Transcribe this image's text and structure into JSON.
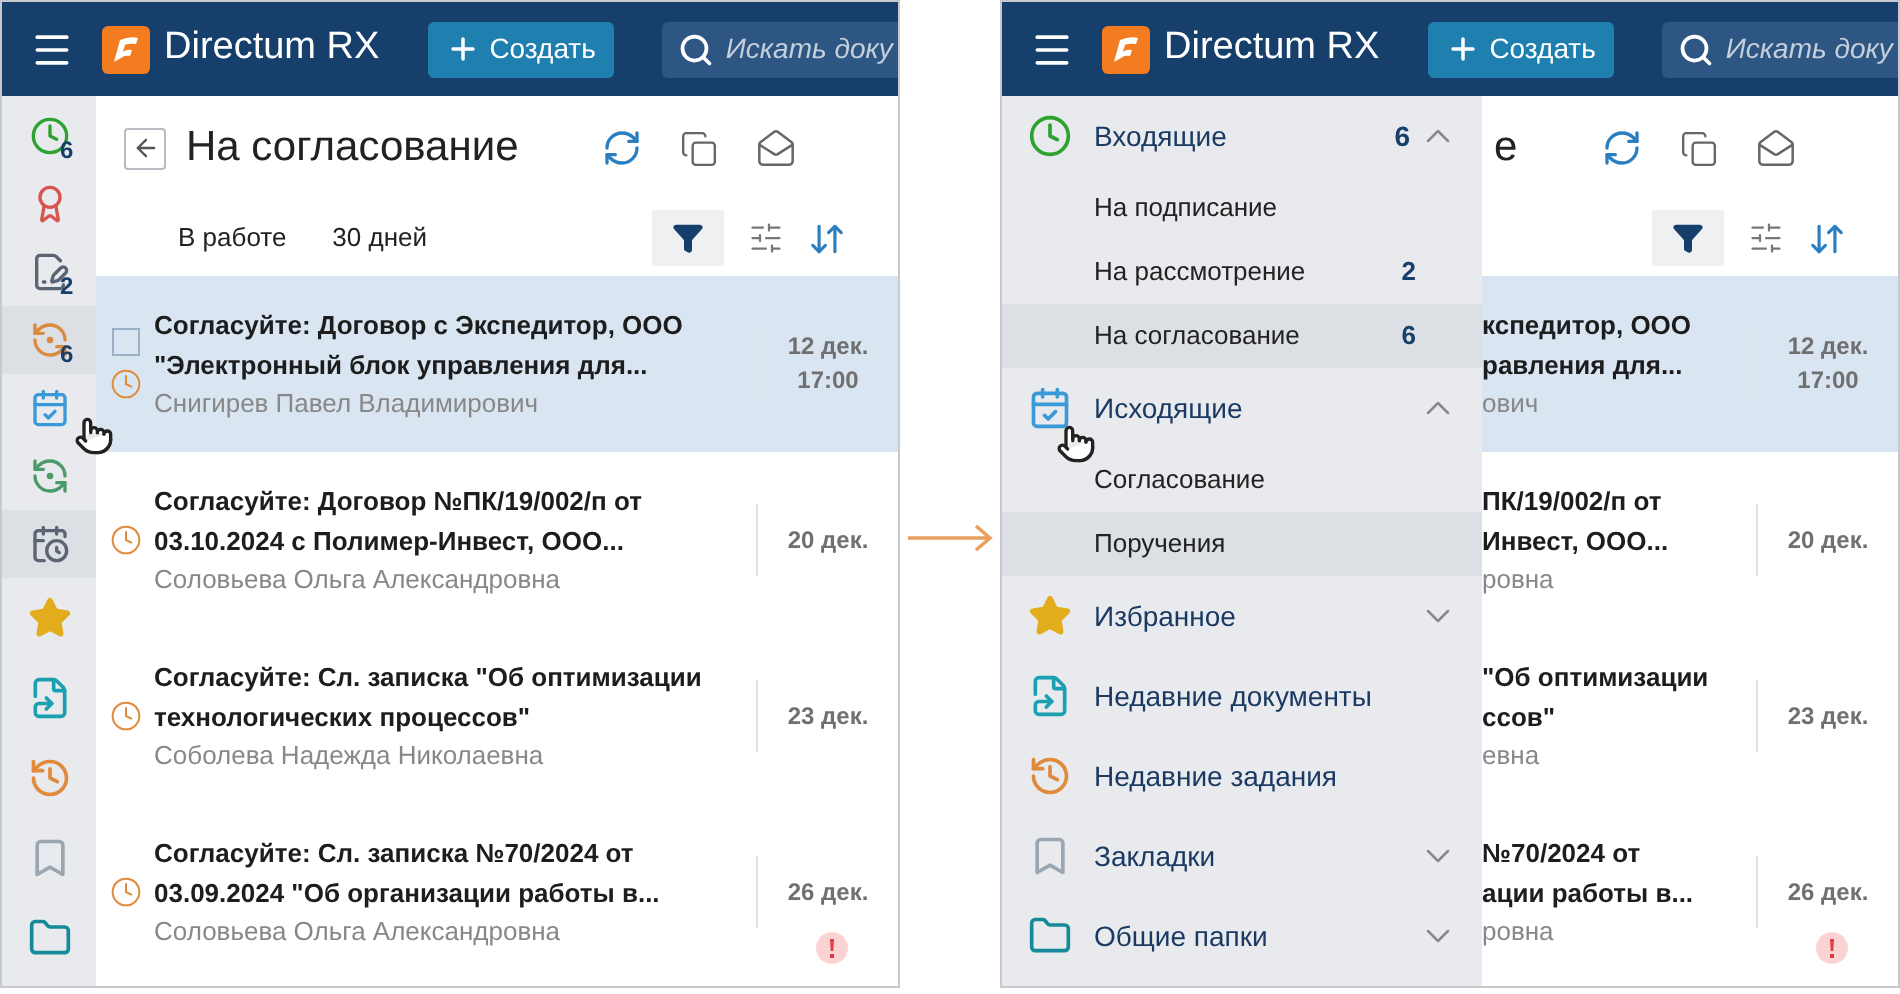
{
  "left_screen": {
    "header": {
      "app_name": "Directum RX",
      "create_button": "Создать",
      "search_placeholder": "Искать доку"
    },
    "rail": [
      {
        "badge": "6",
        "selected": false
      },
      {
        "selected": false
      },
      {
        "badge": "2",
        "selected": false
      },
      {
        "badge": "6",
        "selected": true
      },
      {
        "selected": false
      },
      {
        "selected": false
      },
      {
        "selected": true
      },
      {
        "selected": false
      },
      {
        "selected": false
      },
      {
        "selected": false
      },
      {
        "selected": false
      },
      {
        "selected": false
      }
    ],
    "page": {
      "title": "На согласование",
      "filters": [
        "В работе",
        "30 дней"
      ],
      "tasks": [
        {
          "lines": [
            "Согласуйте: Договор с Экспедитор, ООО",
            "\"Электронный блок управления для..."
          ],
          "author": "Снигирев Павел Владимирович",
          "date": "12 дек.",
          "time": "17:00",
          "selected": true,
          "checked": false,
          "important": false
        },
        {
          "lines": [
            "Согласуйте: Договор №ПК/19/002/п от",
            "03.10.2024 с Полимер-Инвест, ООО..."
          ],
          "author": "Соловьева Ольга Александровна",
          "date": "20 дек.",
          "selected": false,
          "important": false
        },
        {
          "lines": [
            "Согласуйте: Сл. записка \"Об оптимизации",
            "технологических процессов\""
          ],
          "author": "Соболева Надежда Николаевна",
          "date": "23 дек.",
          "selected": false,
          "important": false
        },
        {
          "lines": [
            "Согласуйте: Сл. записка №70/2024 от",
            "03.09.2024 \"Об организации работы в..."
          ],
          "author": "Соловьева Ольга Александровна",
          "date": "26 дек.",
          "selected": false,
          "important": true
        }
      ]
    }
  },
  "right_screen": {
    "header": {
      "app_name": "Directum RX",
      "create_button": "Создать",
      "search_placeholder": "Искать доку"
    },
    "menu": [
      {
        "label": "Входящие",
        "count": "6",
        "expanded": true,
        "children": [
          {
            "label": "На подписание",
            "selected": false
          },
          {
            "label": "На рассмотрение",
            "count": "2",
            "selected": false
          },
          {
            "label": "На согласование",
            "count": "6",
            "selected": true
          }
        ]
      },
      {
        "label": "Исходящие",
        "expanded": true,
        "children": [
          {
            "label": "Согласование",
            "selected": false
          },
          {
            "label": "Поручения",
            "selected": true
          }
        ]
      },
      {
        "label": "Избранное",
        "expanded": false
      },
      {
        "label": "Недавние документы"
      },
      {
        "label": "Недавние задания"
      },
      {
        "label": "Закладки",
        "expanded": false
      },
      {
        "label": "Общие папки",
        "expanded": false
      }
    ],
    "page": {
      "title": "е",
      "tasks": [
        {
          "lines": [
            "кспедитор, ООО",
            "равления для..."
          ],
          "author": "ович",
          "date": "12 дек.",
          "time": "17:00",
          "selected": true,
          "important": false
        },
        {
          "lines": [
            "ПК/19/002/п от",
            "Инвест, ООО..."
          ],
          "author": "ровна",
          "date": "20 дек.",
          "selected": false,
          "important": false
        },
        {
          "lines": [
            "\"Об оптимизации",
            "ссов\""
          ],
          "author": "евна",
          "date": "23 дек.",
          "selected": false,
          "important": false
        },
        {
          "lines": [
            "№70/2024 от",
            "ации работы в..."
          ],
          "author": "ровна",
          "date": "26 дек.",
          "selected": false,
          "important": true
        }
      ]
    }
  }
}
